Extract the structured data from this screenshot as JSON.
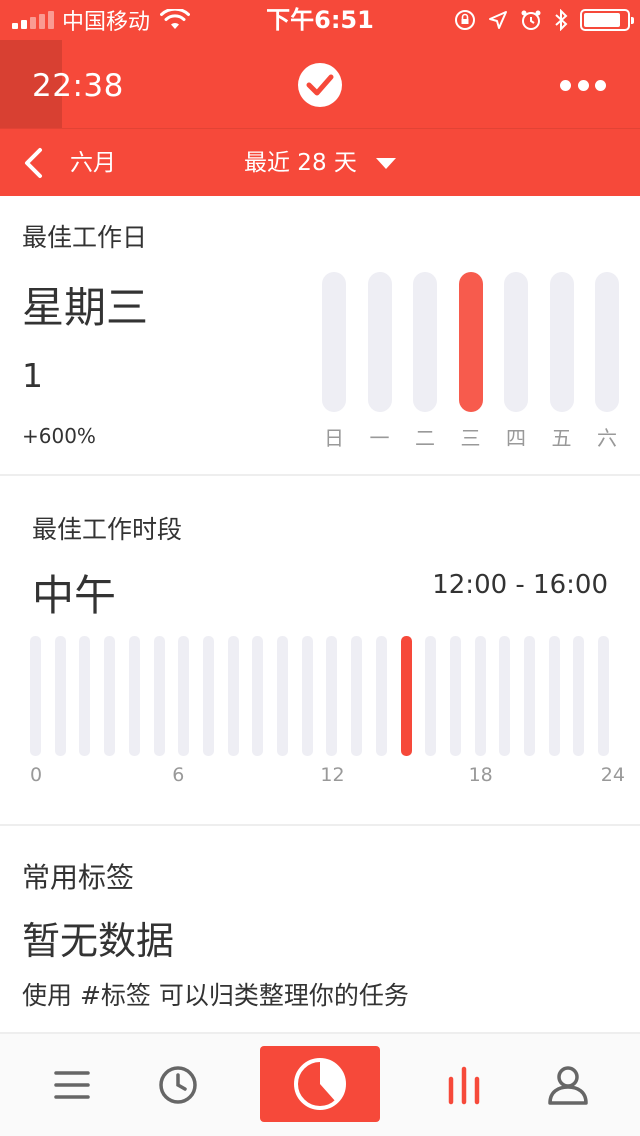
{
  "status_bar": {
    "carrier": "中国移动",
    "time": "下午6:51",
    "battery_level": 0.85
  },
  "header": {
    "timer": "22:38"
  },
  "subheader": {
    "month": "六月",
    "range": "最近 28 天"
  },
  "best_day": {
    "title": "最佳工作日",
    "value": "星期三",
    "count": "1",
    "change": "+600%",
    "days": [
      "日",
      "一",
      "二",
      "三",
      "四",
      "五",
      "六"
    ],
    "active_index": 3
  },
  "best_time": {
    "title": "最佳工作时段",
    "value": "中午",
    "range": "12:00 - 16:00",
    "axis_labels": [
      "0",
      "6",
      "12",
      "18",
      "24"
    ],
    "bar_count": 24,
    "active_index": 15
  },
  "tags": {
    "title": "常用标签",
    "value": "暂无数据",
    "hint": "使用 #标签 可以归类整理你的任务"
  },
  "tabbar": {
    "items": [
      "list-icon",
      "clock-icon",
      "focus-timer-icon",
      "statistics-icon",
      "profile-icon"
    ],
    "active": "statistics-icon"
  },
  "colors": {
    "accent": "#f6493a",
    "bar_inactive": "#eeeef4"
  }
}
